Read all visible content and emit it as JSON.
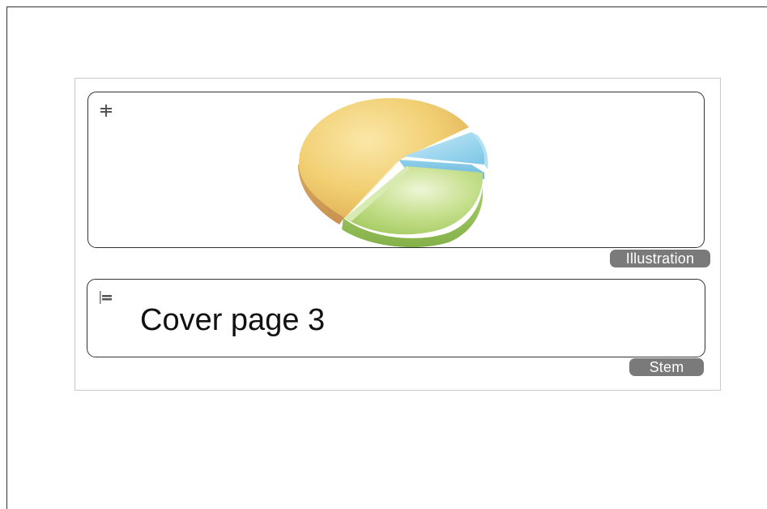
{
  "document": {
    "blocks": [
      {
        "type": "illustration",
        "tag_label": "Illustration",
        "image": "3d-pie-chart-image"
      },
      {
        "type": "stem",
        "tag_label": "Stem",
        "text": "Cover page 3"
      }
    ]
  },
  "colors": {
    "tag_background": "#7a7a7a",
    "block_border": "#333333",
    "page_border": "#c8c8c8",
    "pie_yellow": "#f2d27a",
    "pie_green": "#a9cf6a",
    "pie_blue": "#8fd0ec"
  },
  "icons": {
    "illustration_handle": "move-handle-icon",
    "stem_handle": "align-left-icon"
  }
}
